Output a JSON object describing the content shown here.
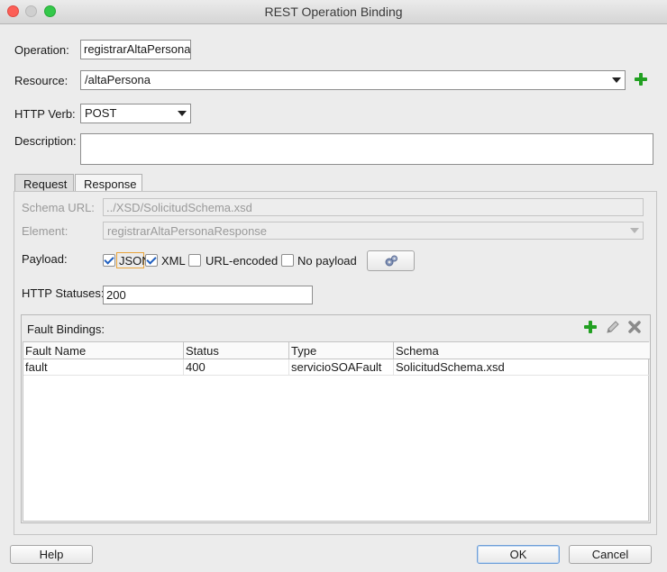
{
  "window": {
    "title": "REST Operation Binding"
  },
  "form": {
    "operation_label": "Operation:",
    "operation_value": "registrarAltaPersona",
    "resource_label": "Resource:",
    "resource_value": "/altaPersona",
    "http_verb_label": "HTTP Verb:",
    "http_verb_value": "POST",
    "description_label": "Description:",
    "description_value": ""
  },
  "tabs": [
    {
      "label": "Request",
      "active": false
    },
    {
      "label": "Response",
      "active": true
    }
  ],
  "response": {
    "schema_url_label": "Schema URL:",
    "schema_url_value": "../XSD/SolicitudSchema.xsd",
    "element_label": "Element:",
    "element_value": "registrarAltaPersonaResponse",
    "payload_label": "Payload:",
    "payload_options": [
      {
        "label": "JSON",
        "checked": true
      },
      {
        "label": "XML",
        "checked": true
      },
      {
        "label": "URL-encoded",
        "checked": false
      },
      {
        "label": "No payload",
        "checked": false
      }
    ],
    "http_statuses_label": "HTTP Statuses:",
    "http_statuses_value": "200"
  },
  "fault_bindings": {
    "title": "Fault Bindings:",
    "columns": [
      "Fault Name",
      "Status",
      "Type",
      "Schema"
    ],
    "rows": [
      {
        "fault_name": "fault",
        "status": "400",
        "type": "servicioSOAFault",
        "schema": "SolicitudSchema.xsd"
      }
    ]
  },
  "buttons": {
    "help": "Help",
    "ok": "OK",
    "cancel": "Cancel"
  },
  "colors": {
    "add_icon": "#22a022",
    "checkbox_check": "#1f5fbf",
    "focus_ring": "#e8a33a"
  }
}
